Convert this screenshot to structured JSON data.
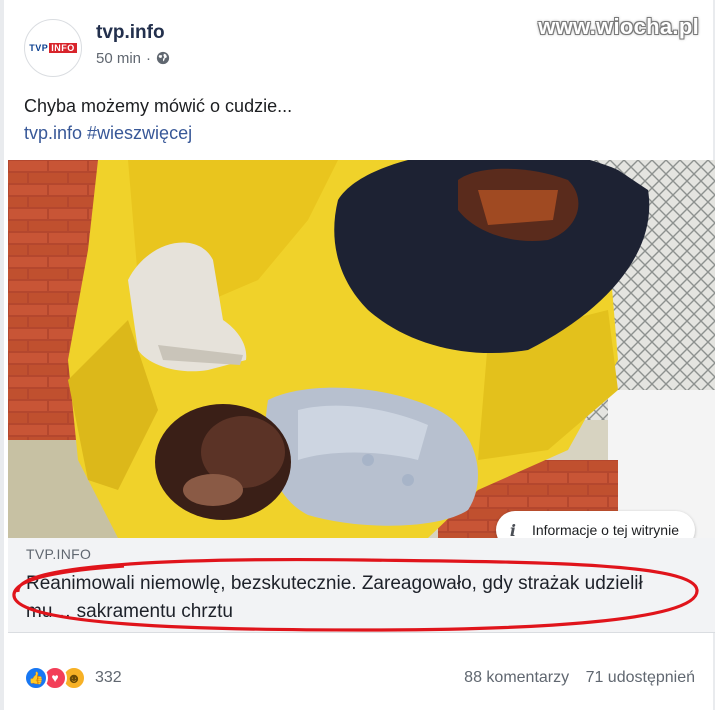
{
  "watermark": "www.wiocha.pl",
  "header": {
    "avatar_logo_tvp": "TVP",
    "avatar_logo_info": "INFO",
    "page_name": "tvp.info",
    "time": "50 min",
    "separator": "·",
    "privacy_icon": "globe-icon"
  },
  "post": {
    "text": "Chyba możemy mówić o cudzie...",
    "link_text": "tvp.info #wieszwięcej"
  },
  "info_button": {
    "icon": "info-icon",
    "label": "Informacje o tej witrynie"
  },
  "link_preview": {
    "domain": "TVP.INFO",
    "headline": "Reanimowali niemowlę, bezskutecznie. Zareagowało, gdy strażak udzielił mu… sakramentu chrztu"
  },
  "footer": {
    "reaction_icons": [
      "like-icon",
      "love-icon",
      "haha-icon"
    ],
    "reaction_count": "332",
    "comments": "88 komentarzy",
    "shares": "71 udostępnień"
  },
  "colors": {
    "link": "#385898",
    "annotation_red": "#e0141b",
    "like_blue": "#1877f2",
    "love_red": "#f33e58",
    "haha_yellow": "#f7b125"
  }
}
